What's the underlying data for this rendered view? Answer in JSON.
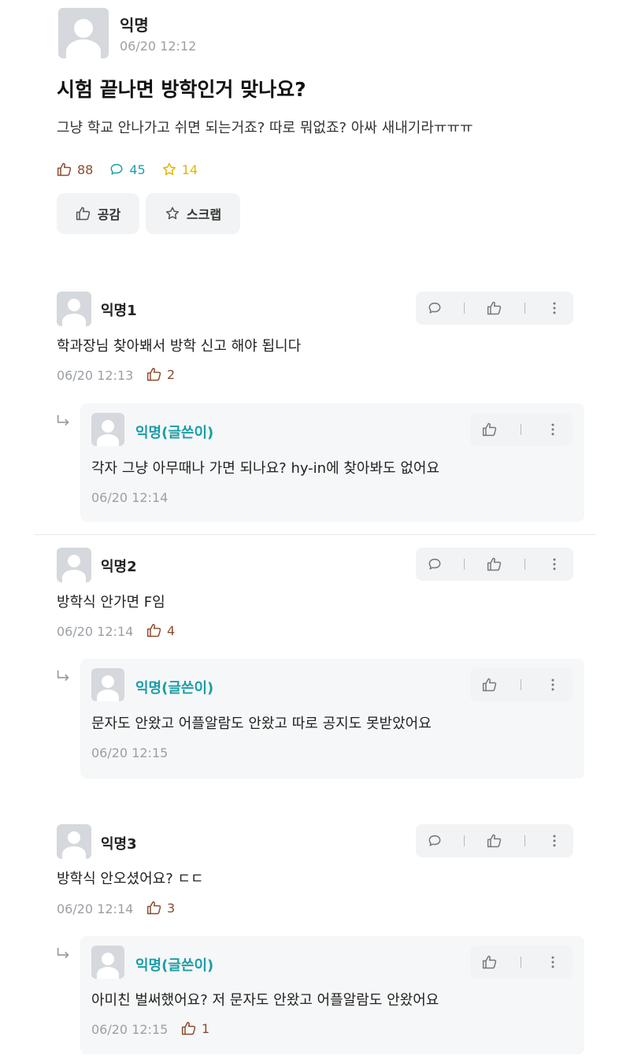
{
  "post": {
    "author": "익명",
    "time": "06/20 12:12",
    "title": "시험 끝나면 방학인거 맞나요?",
    "body": "그냥 학교 안나가고 쉬면 되는거죠? 따로 뭐없죠? 아싸 새내기라ㅠㅠㅠ",
    "like_count": "88",
    "comment_count": "45",
    "scrap_count": "14",
    "like_button": "공감",
    "scrap_button": "스크랩",
    "colors": {
      "like": "#8a4d2e",
      "comment": "#1f9fb3",
      "scrap": "#e6b400"
    }
  },
  "comments": [
    {
      "author": "익명1",
      "text": "학과장님 찾아봬서 방학 신고 해야 됩니다",
      "time": "06/20 12:13",
      "likes": "2",
      "reply": {
        "author": "익명(글쓴이)",
        "text": "각자 그냥 아무때나 가면 되나요? hy-in에 찾아봐도 없어요",
        "time": "06/20 12:14"
      }
    },
    {
      "author": "익명2",
      "text": "방학식 안가면 F임",
      "time": "06/20 12:14",
      "likes": "4",
      "reply": {
        "author": "익명(글쓴이)",
        "text": "문자도 안왔고 어플알람도 안왔고 따로 공지도 못받았어요",
        "time": "06/20 12:15"
      }
    },
    {
      "author": "익명3",
      "text": "방학식 안오셨어요? ㄷㄷ",
      "time": "06/20 12:14",
      "likes": "3",
      "reply": {
        "author": "익명(글쓴이)",
        "text": "아미친 벌써했어요? 저 문자도 안왔고 어플알람도 안왔어요",
        "time": "06/20 12:15",
        "likes": "1"
      }
    }
  ],
  "icons": [
    "thumbs-up-icon",
    "speech-bubble-icon",
    "star-icon",
    "more-vertical-icon",
    "reply-arrow-icon",
    "avatar-icon"
  ]
}
